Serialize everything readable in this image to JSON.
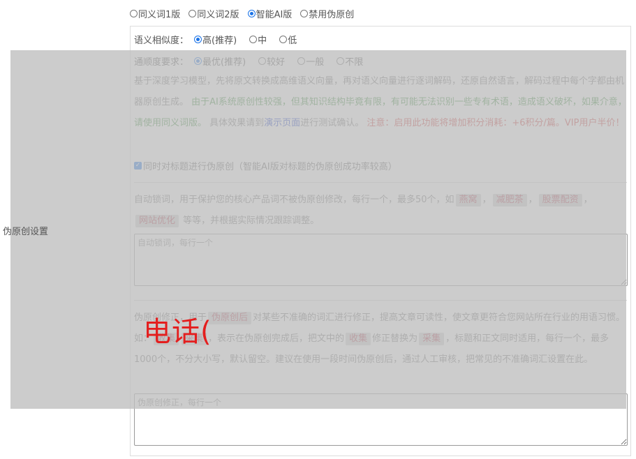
{
  "version_options": [
    {
      "label": "同义词1版",
      "checked": false
    },
    {
      "label": "同义词2版",
      "checked": false
    },
    {
      "label": "智能AI版",
      "checked": true
    },
    {
      "label": "禁用伪原创",
      "checked": false
    }
  ],
  "side_label": "伪原创设置",
  "similarity": {
    "label": "语义相似度：",
    "options": [
      {
        "label": "高(推荐)",
        "checked": true
      },
      {
        "label": "中",
        "checked": false
      },
      {
        "label": "低",
        "checked": false
      }
    ]
  },
  "fluency": {
    "label": "通顺度要求：",
    "options": [
      {
        "label": "最优(推荐)",
        "checked": true
      },
      {
        "label": "较好",
        "checked": false
      },
      {
        "label": "一般",
        "checked": false
      },
      {
        "label": "不限",
        "checked": false
      }
    ]
  },
  "ai_desc": {
    "intro": "基于深度学习模型，先将原文转换成高维语义向量，再对语义向量进行逐词解码，还原自然语言，解码过程中每个字都由机器原创生成。",
    "green_note": "由于AI系统原创性较强，但其知识结构毕竟有限，有可能无法识别一些专有术语，造成语义破坏，如果介意，请使用同义词版。",
    "demo_prefix": "具体效果请到",
    "demo_link": "演示页面",
    "demo_suffix": "进行测试确认。",
    "red_note": "注意：启用此功能将增加积分消耗：+6积分/篇。VIP用户半价！"
  },
  "title_checkbox": {
    "label": "同时对标题进行伪原创（智能AI版对标题的伪原创成功率较高）",
    "checked": true
  },
  "lock_words": {
    "desc_prefix": "自动锁词，用于保护您的核心产品词不被伪原创修改，每行一个，最多50个，如",
    "tags": [
      "燕窝",
      "减肥茶",
      "股票配资",
      "网站优化"
    ],
    "desc_suffix": "等等，并根据实际情况跟踪调整。",
    "placeholder": "自动锁词，每行一个"
  },
  "correction": {
    "part1": "伪原创修正，用于",
    "tag1": "伪原创后",
    "part2": "对某些不准确的词汇进行修正，提高文章可读性，使文章更符合您网站所在行业的用语习惯。如：",
    "tag2": "收集",
    "tag3": "采集",
    "part3": "，表示在伪原创完成后，把文中的",
    "tag4": "收集",
    "part4": "修正替换为",
    "tag5": "采集",
    "part5": "，标题和正文同时适用，每行一个，最多1000个，不分大小写，默认留空。建议在使用一段时间伪原创后，通过人工审核，把常见的不准确词汇设置在此。",
    "placeholder": "伪原创修正，每行一个"
  },
  "watermark": "电话(",
  "colors": {
    "accent": "#1a73e8",
    "green": "#3c8c3c",
    "red": "#d23c3c",
    "link": "#1a3cc8",
    "watermark": "#e41e1e"
  }
}
